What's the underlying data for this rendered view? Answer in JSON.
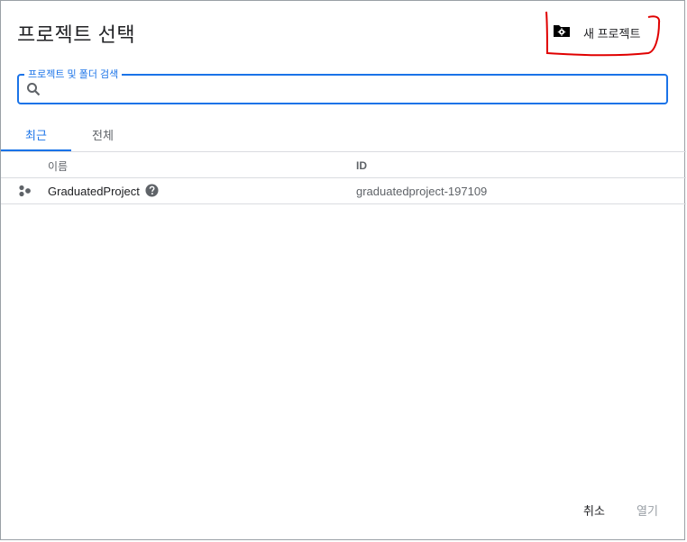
{
  "dialog": {
    "title": "프로젝트 선택",
    "new_project_label": "새 프로젝트",
    "new_project_icon": "folder-settings-icon"
  },
  "search": {
    "label": "프로젝트 및 폴더 검색",
    "value": "",
    "icon": "search-icon"
  },
  "tabs": [
    {
      "label": "최근",
      "active": true
    },
    {
      "label": "전체",
      "active": false
    }
  ],
  "table": {
    "columns": [
      "이름",
      "ID"
    ],
    "rows": [
      {
        "name": "GraduatedProject",
        "id": "graduatedproject-197109",
        "icon": "project-icon",
        "help_icon": "help-icon"
      }
    ]
  },
  "footer": {
    "cancel_label": "취소",
    "open_label": "열기"
  },
  "colors": {
    "accent": "#1a73e8",
    "annotation": "#e00000"
  }
}
